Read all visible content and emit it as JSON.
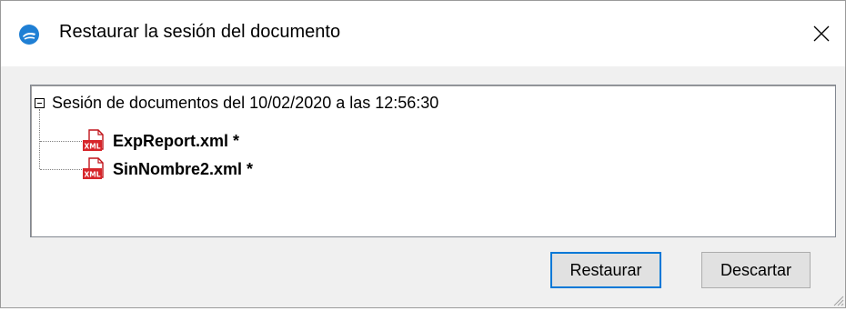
{
  "window": {
    "title": "Restaurar la sesión del documento",
    "icon": "altova-app-icon",
    "close_icon": "close-icon"
  },
  "tree": {
    "root_label": "Sesión de documentos del 10/02/2020 a las 12:56:30",
    "items": [
      {
        "label": "ExpReport.xml *",
        "icon": "xml-file-icon"
      },
      {
        "label": "SinNombre2.xml *",
        "icon": "xml-file-icon"
      }
    ]
  },
  "buttons": {
    "restore_label": "Restaurar",
    "discard_label": "Descartar"
  },
  "colors": {
    "accent": "#0078d7",
    "dialog_bg": "#f0f0f0",
    "xml_icon_red": "#d7262b"
  }
}
